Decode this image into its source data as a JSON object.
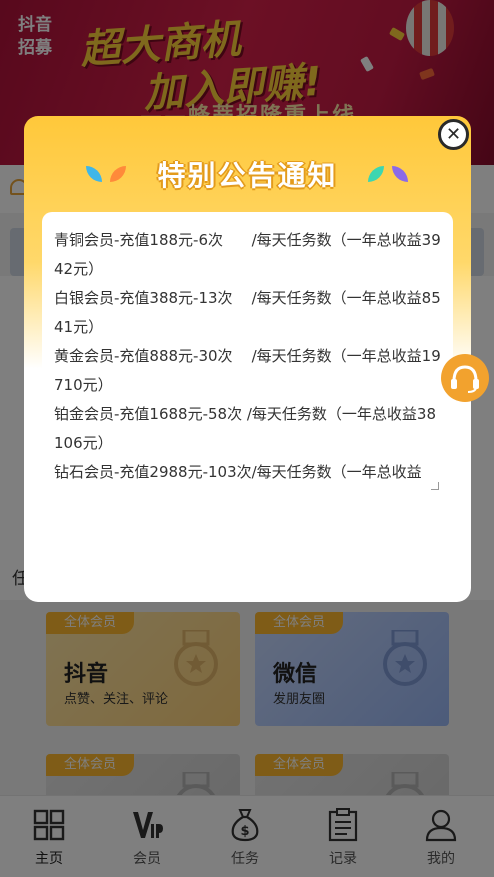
{
  "banner": {
    "logo_text": "抖音招募",
    "title_line1": "超大商机",
    "title_line2": "加入即赚!",
    "subtitle": "——蜂蒂招隆重上线"
  },
  "section": {
    "label": "任"
  },
  "cards": [
    {
      "badge": "全体会员",
      "title": "抖音",
      "desc": "点赞、关注、评论",
      "color": "yellow"
    },
    {
      "badge": "全体会员",
      "title": "微信",
      "desc": "发朋友圈",
      "color": "blue"
    },
    {
      "badge": "全体会员",
      "title": "",
      "desc": "",
      "color": "grey"
    },
    {
      "badge": "全体会员",
      "title": "",
      "desc": "",
      "color": "grey"
    }
  ],
  "tabbar": {
    "items": [
      {
        "label": "主页",
        "icon": "home-grid-icon",
        "active": true
      },
      {
        "label": "会员",
        "icon": "vip-icon",
        "active": false
      },
      {
        "label": "任务",
        "icon": "money-bag-icon",
        "active": false
      },
      {
        "label": "记录",
        "icon": "clipboard-icon",
        "active": false
      },
      {
        "label": "我的",
        "icon": "user-icon",
        "active": false
      }
    ]
  },
  "modal": {
    "title": "特别公告通知",
    "close_label": "✕",
    "lines": [
      "青铜会员-充值188元-6次      /每天任务数（一年总收益3942元）",
      "白银会员-充值388元-13次    /每天任务数（一年总收益8541元）",
      "黄金会员-充值888元-30次    /每天任务数（一年总收益19710元）",
      "铂金会员-充值1688元-58次 /每天任务数（一年总收益38106元）",
      "钻石会员-充值2988元-103次/每天任务数（一年总收益"
    ]
  },
  "colors": {
    "accent": "#ffc83a",
    "service": "#f2a22e",
    "banner": "#c61a44"
  }
}
